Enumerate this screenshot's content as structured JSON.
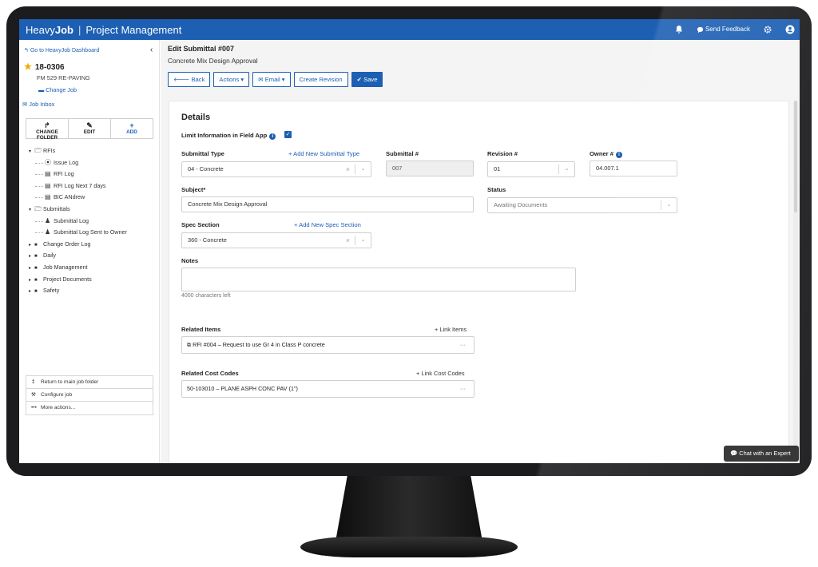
{
  "topbar": {
    "brand_bold": "Heavy",
    "brand_bold2": "Job",
    "brand_rest": "Project Management",
    "send_feedback": "Send Feedback",
    "icons": [
      "bell-icon",
      "chat-bubble-icon",
      "gear-icon",
      "user-icon"
    ]
  },
  "sidebar": {
    "dashboard_link": "Go to HeavyJob Dashboard",
    "job_number": "18-0306",
    "job_name": "FM 529 RE-PAVING",
    "change_job": "Change Job",
    "job_inbox": "Job Inbox",
    "actions": [
      {
        "label": "CHANGE FOLDER",
        "icon": "share-arrow-icon"
      },
      {
        "label": "EDIT",
        "icon": "pencil-icon"
      },
      {
        "label": "ADD",
        "icon": "plus-icon"
      }
    ],
    "tree": [
      {
        "label": "RFIs",
        "level": 1,
        "expanded": true,
        "type": "folder-open"
      },
      {
        "label": "Issue Log",
        "level": 2,
        "type": "issue"
      },
      {
        "label": "RFI Log",
        "level": 2,
        "type": "log"
      },
      {
        "label": "RFI Log Next 7 days",
        "level": 2,
        "type": "log"
      },
      {
        "label": "BIC ANdrew",
        "level": 2,
        "type": "log"
      },
      {
        "label": "Submittals",
        "level": 1,
        "expanded": true,
        "type": "folder-open"
      },
      {
        "label": "Submittal Log",
        "level": 2,
        "type": "stamp"
      },
      {
        "label": "Submittal Log Sent to Owner",
        "level": 2,
        "type": "stamp"
      },
      {
        "label": "Change Order Log",
        "level": 1,
        "expanded": false,
        "type": "folder"
      },
      {
        "label": "Daily",
        "level": 1,
        "expanded": false,
        "type": "folder"
      },
      {
        "label": "Job Management",
        "level": 1,
        "expanded": false,
        "type": "folder"
      },
      {
        "label": "Project Documents",
        "level": 1,
        "expanded": false,
        "type": "folder"
      },
      {
        "label": "Safety",
        "level": 1,
        "expanded": false,
        "type": "folder"
      }
    ],
    "bottom_actions": [
      {
        "label": "Return to main job folder",
        "icon": "return-arrow-icon"
      },
      {
        "label": "Configure job",
        "icon": "wrench-icon"
      },
      {
        "label": "More actions...",
        "icon": "ellipsis-icon"
      }
    ]
  },
  "header": {
    "title": "Edit Submittal #007",
    "subtitle": "Concrete Mix Design Approval",
    "buttons": {
      "back": "Back",
      "actions": "Actions",
      "email": "Email",
      "create_revision": "Create Revision",
      "save": "Save"
    }
  },
  "details": {
    "heading": "Details",
    "limit_label": "Limit Information in Field App",
    "limit_checked": true,
    "submittal_type_label": "Submittal Type",
    "add_submittal_type": "Add New Submittal Type",
    "submittal_type_value": "04 - Concrete",
    "submittal_num_label": "Submittal #",
    "submittal_num_value": "007",
    "revision_label": "Revision #",
    "revision_value": "01",
    "owner_label": "Owner #",
    "owner_value": "04.007.1",
    "subject_label": "Subject*",
    "subject_value": "Concrete Mix Design Approval",
    "status_label": "Status",
    "status_value": "Awaiting Documents",
    "spec_label": "Spec Section",
    "add_spec": "Add New Spec Section",
    "spec_value": "360 - Concrete",
    "notes_label": "Notes",
    "notes_value": "",
    "notes_remaining": "4000 characters left",
    "related_items_label": "Related Items",
    "link_items": "Link Items",
    "related_item": "RFI #004 – Request to use Gr 4 in Class P concrete",
    "cost_codes_label": "Related Cost Codes",
    "link_cost_codes": "Link Cost Codes",
    "cost_code": "50-103010 – PLANE ASPH CONC PAV (1\")"
  },
  "chat": {
    "label": "Chat with an Expert"
  },
  "colors": {
    "brand_blue": "#1d5fb3",
    "star": "#f2a900"
  }
}
